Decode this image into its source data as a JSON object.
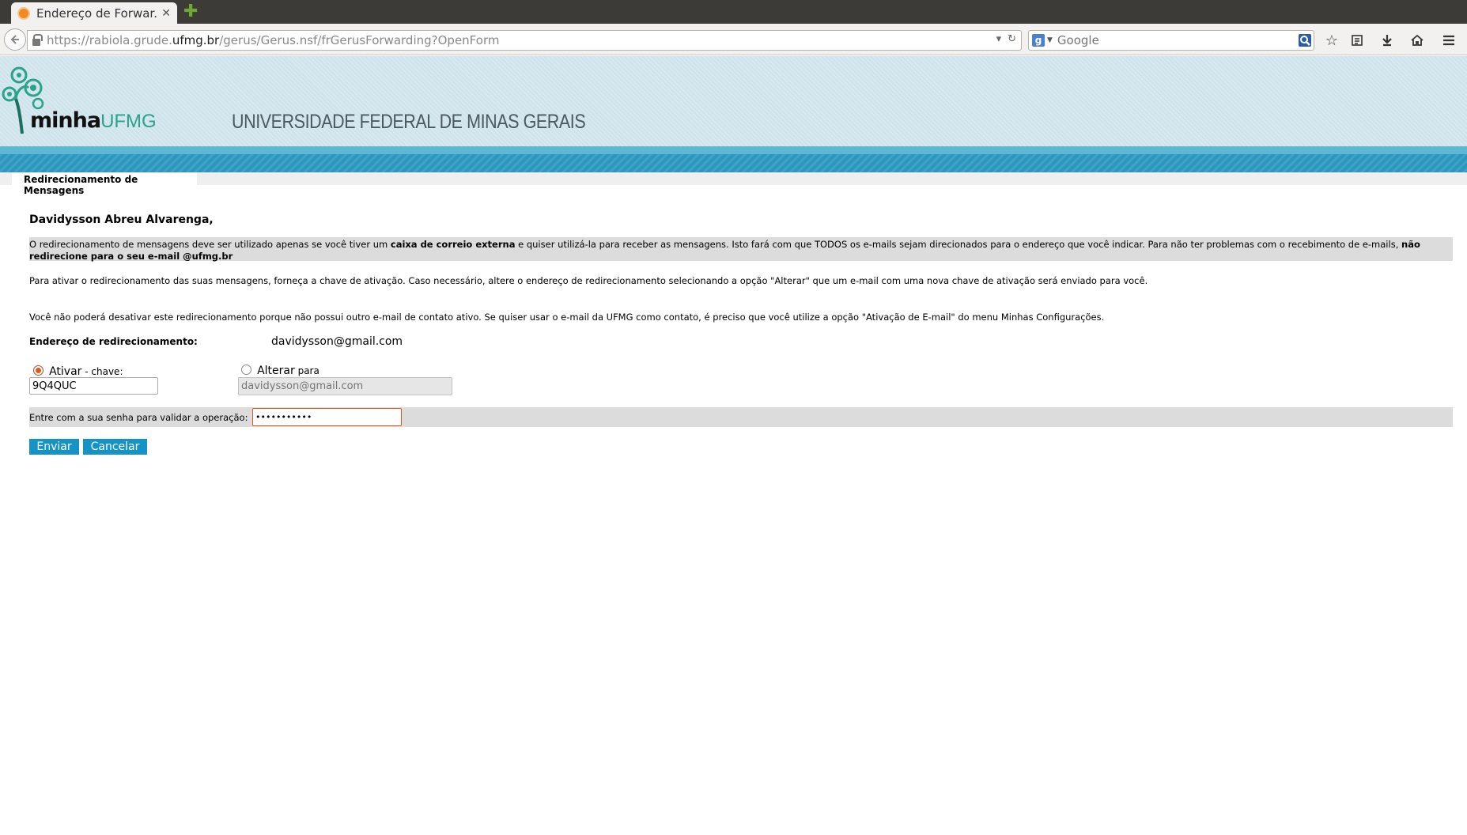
{
  "browser": {
    "tab_title": "Endereço de Forwar...",
    "tab_close": "✕",
    "new_tab": "✚",
    "url_prefix": "https://rabiola.grude.",
    "url_host": "ufmg.br",
    "url_path": "/gerus/Gerus.nsf/frGerusForwarding?OpenForm",
    "search_placeholder": "Google",
    "search_engine_letter": "g"
  },
  "header": {
    "logo_minha": "minha",
    "logo_ufmg": "UFMG",
    "university_name": "UNIVERSIDADE FEDERAL DE MINAS GERAIS",
    "tab_label": "Redirecionamento de Mensagens"
  },
  "content": {
    "greeting": "Davidysson Abreu Alvarenga,",
    "notice": {
      "part1": "O redirecionamento de mensagens deve ser utilizado apenas se você tiver um ",
      "bold1": "caixa de correio externa",
      "part2": " e quiser utilizá-la para receber as mensagens. Isto fará com que TODOS os e-mails sejam direcionados para o endereço que você indicar. Para não ter problemas com o recebimento de e-mails, ",
      "bold2": "não redirecione para o seu e-mail @ufmg.br"
    },
    "para_activate": "Para ativar o redirecionamento das suas mensagens, forneça a chave de ativação. Caso necessário, altere o endereço de redirecionamento selecionando a opção \"Alterar\" que um e-mail com uma nova chave de ativação será enviado para você.",
    "para_warning": "Você não poderá desativar este redirecionamento porque não possui outro e-mail de contato ativo. Se quiser usar o e-mail da UFMG como contato, é preciso que você utilize a opção \"Ativação de E-mail\" do menu Minhas Configurações.",
    "address_label": "Endereço de redirecionamento:",
    "address_value": "davidysson@gmail.com",
    "option_activate": "Ativar",
    "option_activate_suffix": " - chave:",
    "activation_key": "9Q4QUC",
    "option_change": "Alterar",
    "option_change_suffix": " para",
    "change_placeholder": "davidysson@gmail.com",
    "password_label": "Entre com a sua senha para validar a operação:",
    "password_value": "•••••••••••",
    "send_label": "Enviar",
    "cancel_label": "Cancelar"
  },
  "colors": {
    "accent_blue": "#1592c6",
    "radio_orange": "#e0561b",
    "logo_green": "#2aa38b"
  }
}
